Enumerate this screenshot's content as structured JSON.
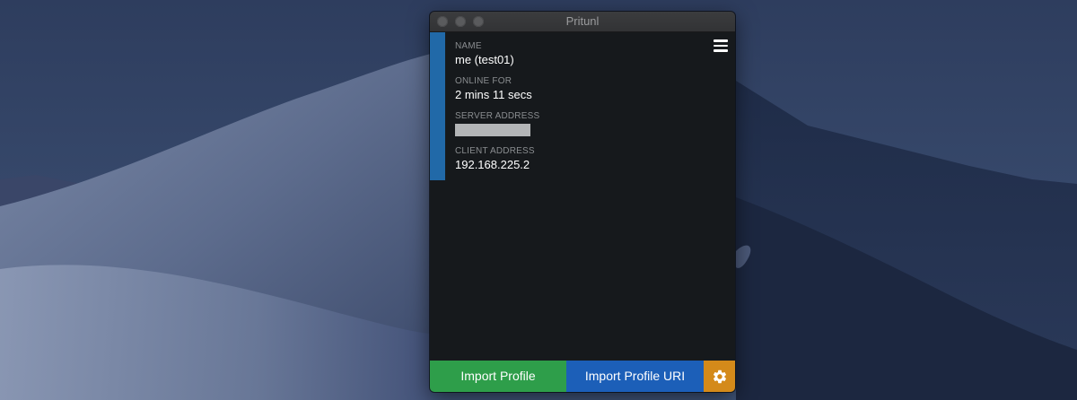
{
  "window": {
    "title": "Pritunl"
  },
  "profile": {
    "name_label": "NAME",
    "name_value": "me (test01)",
    "online_label": "ONLINE FOR",
    "online_value": "2 mins 11 secs",
    "server_label": "SERVER ADDRESS",
    "client_label": "CLIENT ADDRESS",
    "client_value": "192.168.225.2",
    "status_color": "#2169a8"
  },
  "toolbar": {
    "import_profile_label": "Import Profile",
    "import_profile_uri_label": "Import Profile URI",
    "settings_icon": "gear-icon",
    "menu_icon": "hamburger-menu-icon"
  },
  "colors": {
    "import_profile": "#2e9e4a",
    "import_profile_uri": "#1c5fb8",
    "settings": "#d48a1a"
  }
}
